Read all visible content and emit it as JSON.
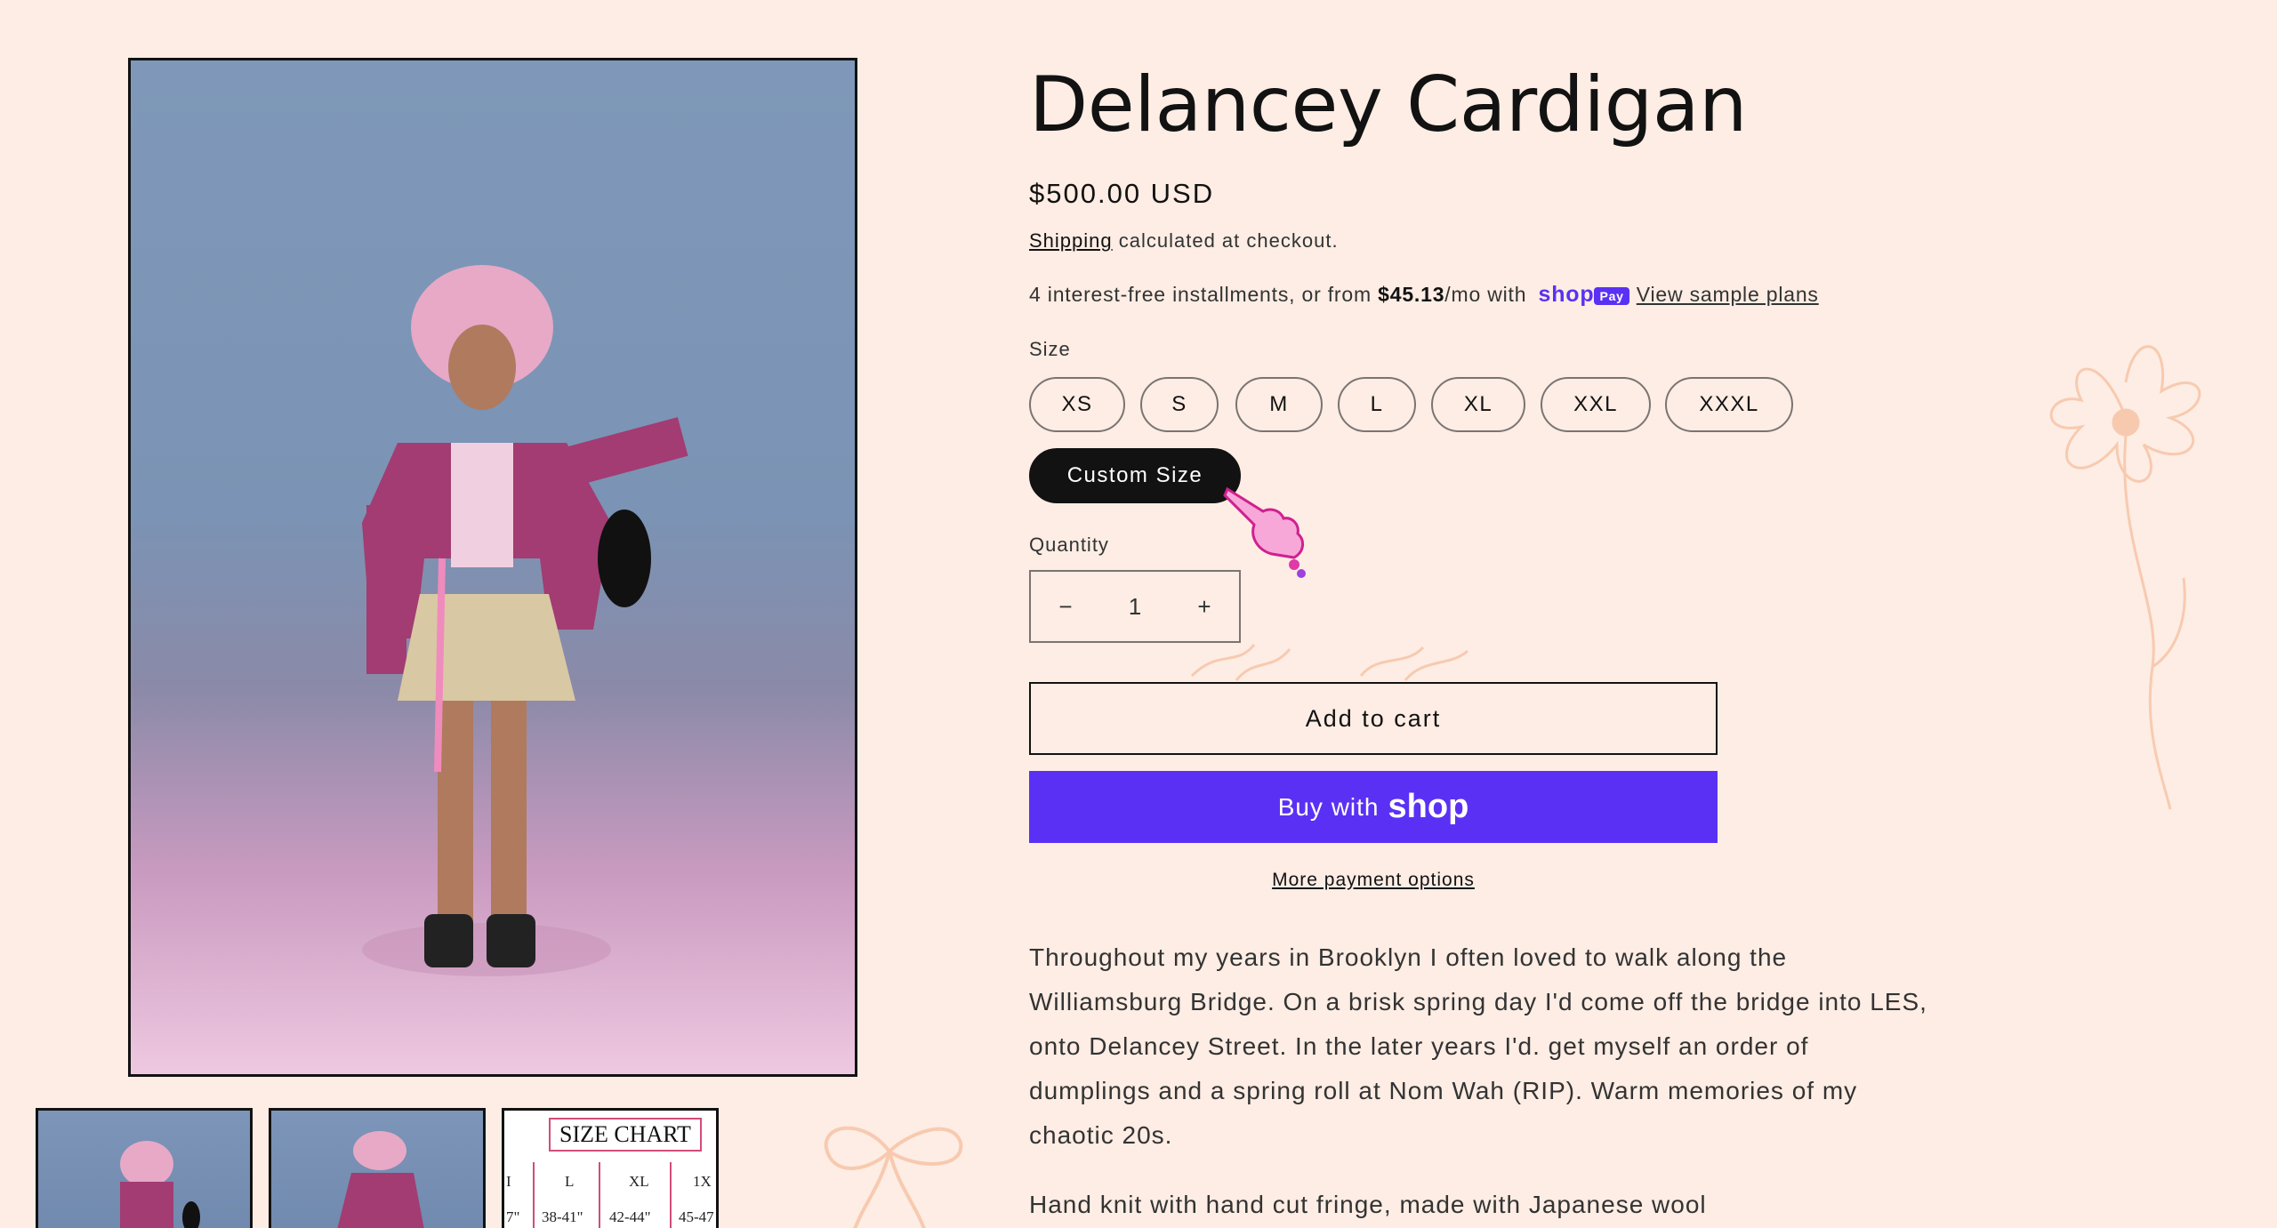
{
  "colors": {
    "background": "#fdede4",
    "accent": "#5a31f4",
    "text": "#121212",
    "selected_pill": "#121212"
  },
  "product": {
    "title": "Delancey Cardigan",
    "price": "$500.00 USD",
    "shipping_link": "Shipping",
    "shipping_text": " calculated at checkout.",
    "installments_prefix": "4 interest-free installments, or from ",
    "installments_amount": "$45.13",
    "installments_suffix": "/mo with ",
    "shop_word": "shop",
    "pay_badge": "Pay",
    "view_plans": "View sample plans"
  },
  "size": {
    "label": "Size",
    "options": [
      "XS",
      "S",
      "M",
      "L",
      "XL",
      "XXL",
      "XXXL",
      "Custom Size"
    ],
    "selected": "Custom Size"
  },
  "quantity": {
    "label": "Quantity",
    "value": "1",
    "minus": "−",
    "plus": "+"
  },
  "buttons": {
    "add_to_cart": "Add to cart",
    "buy_with": "Buy with",
    "buy_shop": "shop",
    "more_payment": "More payment options"
  },
  "description": [
    "Throughout my years in Brooklyn I often loved to walk along the Williamsburg Bridge. On a brisk spring day I'd come off the bridge into LES, onto Delancey Street. In the later years I'd. get myself an order of dumplings and a spring roll at Nom Wah (RIP). Warm memories of my chaotic 20s.",
    "Hand knit with hand cut fringe, made with Japanese wool"
  ],
  "size_chart_thumb": {
    "title": "SIZE CHART",
    "headers": [
      "I",
      "L",
      "XL",
      "1X"
    ],
    "values": [
      "7\"",
      "38-41\"",
      "42-44\"",
      "45-47"
    ]
  },
  "icons": {
    "cursor": "pink-hand-cursor-icon",
    "deco_flower": "flower-outline-icon",
    "deco_bow": "bow-outline-icon"
  }
}
